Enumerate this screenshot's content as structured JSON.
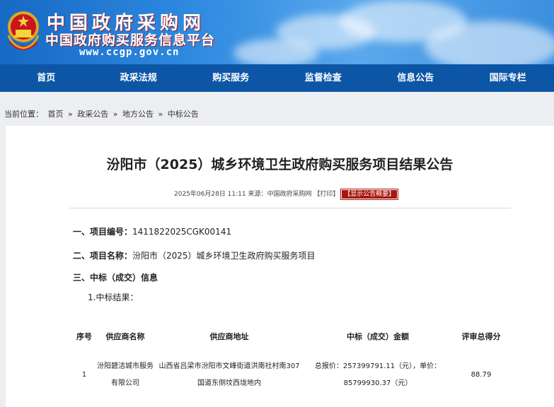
{
  "header": {
    "site_name": "中国政府采购网",
    "site_subtitle": "中国政府购买服务信息平台",
    "site_url": "www.ccgp.gov.cn",
    "emblem_icon": "national-emblem-icon"
  },
  "nav": {
    "items": [
      "首页",
      "政采法规",
      "购买服务",
      "监督检查",
      "信息公告",
      "国际专栏"
    ]
  },
  "breadcrumb": {
    "prefix": "当前位置：",
    "items": [
      "首页",
      "政采公告",
      "地方公告",
      "中标公告"
    ],
    "separator": "»"
  },
  "article": {
    "title": "汾阳市（2025）城乡环境卫生政府购买服务项目结果公告",
    "date": "2025年06月28日 11:11",
    "source_label": "来源：",
    "source": "中国政府采购网",
    "print": "【打印】",
    "summary_button": "【显示公告概要】",
    "sec1_label": "一、项目编号：",
    "sec1_value": "1411822025CGK00141",
    "sec2_label": "二、项目名称：",
    "sec2_value": "汾阳市（2025）城乡环境卫生政府购买服务项目",
    "sec3_label": "三、中标（成交）信息",
    "sub_label": "1.中标结果："
  },
  "table": {
    "headers": [
      "序号",
      "供应商名称",
      "供应商地址",
      "中标（成交）金额",
      "评审总得分"
    ],
    "rows": [
      {
        "no": "1",
        "name": "汾阳碧洁城市服务有限公司",
        "address": "山西省吕梁市汾阳市文峰街道洪南社村南307国道东侧坟西垅地内",
        "amount": "总报价：257399791.11（元），单价：85799930.37（元）",
        "score": "88.79"
      }
    ]
  },
  "colors": {
    "nav_bg": "#0d56a6",
    "accent_red": "#a8160f"
  }
}
